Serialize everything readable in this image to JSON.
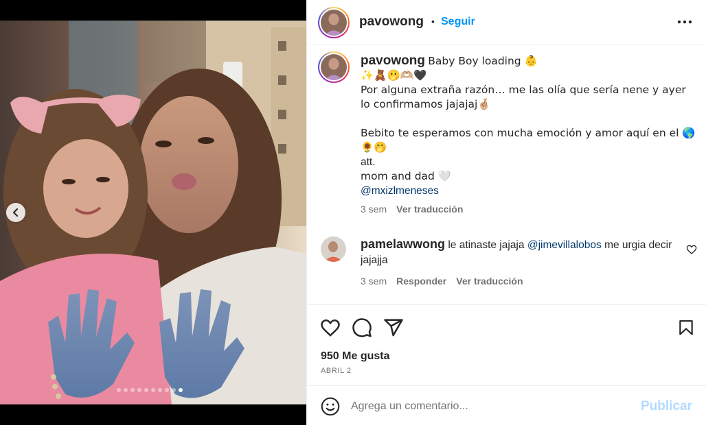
{
  "post": {
    "username": "pavowong",
    "separator": "•",
    "follow_label": "Seguir",
    "more_icon": "more-horizontal-icon",
    "carousel": {
      "slide_count": 10,
      "active_index": 9,
      "prev_icon": "chevron-left-icon"
    }
  },
  "caption": {
    "username": "pavowong",
    "lines": [
      "Baby Boy loading 👶",
      "✨🧸🫢🫶🏼🖤",
      "Por alguna extraña razón… me las olía que sería nene y ayer lo confirmamos jajajaj🤞🏼",
      "",
      "Bebito te esperamos con mucha emoción y amor aquí en el 🌎🌻🤭",
      "att.",
      "mom and dad 🤍"
    ],
    "mention": "@mxizlmeneses",
    "time": "3 sem",
    "translate": "Ver traducción"
  },
  "comment": {
    "username": "pamelawwong",
    "text_before": "le atinaste jajaja",
    "mention": "@jimevillalobos",
    "text_after": "me urgia decir jajajja",
    "time": "3 sem",
    "reply": "Responder",
    "translate": "Ver traducción",
    "like_icon": "heart-outline-icon"
  },
  "actions": {
    "like_icon": "heart-outline-icon",
    "comment_icon": "speech-bubble-icon",
    "share_icon": "paper-plane-icon",
    "save_icon": "bookmark-icon"
  },
  "likes_label": "950 Me gusta",
  "date_label": "ABRIL 2",
  "add_comment": {
    "emoji_icon": "smiley-face-icon",
    "placeholder": "Agrega un comentario...",
    "value": "",
    "post_label": "Publicar"
  },
  "colors": {
    "link_blue": "#0095f6",
    "mention_blue": "#00376b",
    "muted_gray": "#737373",
    "disabled_blue": "#b3dbff"
  }
}
